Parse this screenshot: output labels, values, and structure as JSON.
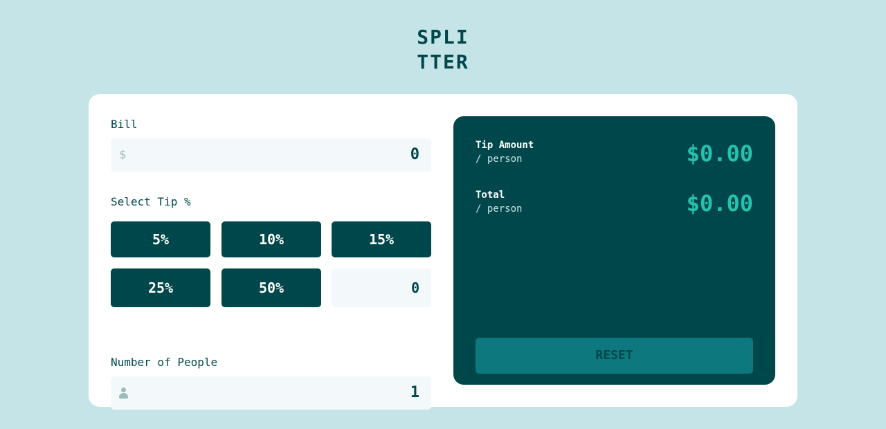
{
  "logo": {
    "line1": "SPLI",
    "line2": "TTER"
  },
  "bill": {
    "label": "Bill",
    "currency_symbol": "$",
    "value": "0"
  },
  "tip": {
    "label": "Select Tip %",
    "options": [
      "5%",
      "10%",
      "15%",
      "25%",
      "50%"
    ],
    "custom_value": "0"
  },
  "people": {
    "label": "Number of People",
    "value": "1",
    "icon": "person-icon"
  },
  "results": {
    "tip_amount": {
      "title": "Tip Amount",
      "sub": "/ person",
      "value": "$0.00"
    },
    "total": {
      "title": "Total",
      "sub": "/ person",
      "value": "$0.00"
    }
  },
  "reset_label": "RESET",
  "colors": {
    "background": "#c5e4e7",
    "dark_cyan": "#00474b",
    "accent": "#26c2ae",
    "input_bg": "#f3f9fa",
    "reset_bg": "#0d787d"
  }
}
